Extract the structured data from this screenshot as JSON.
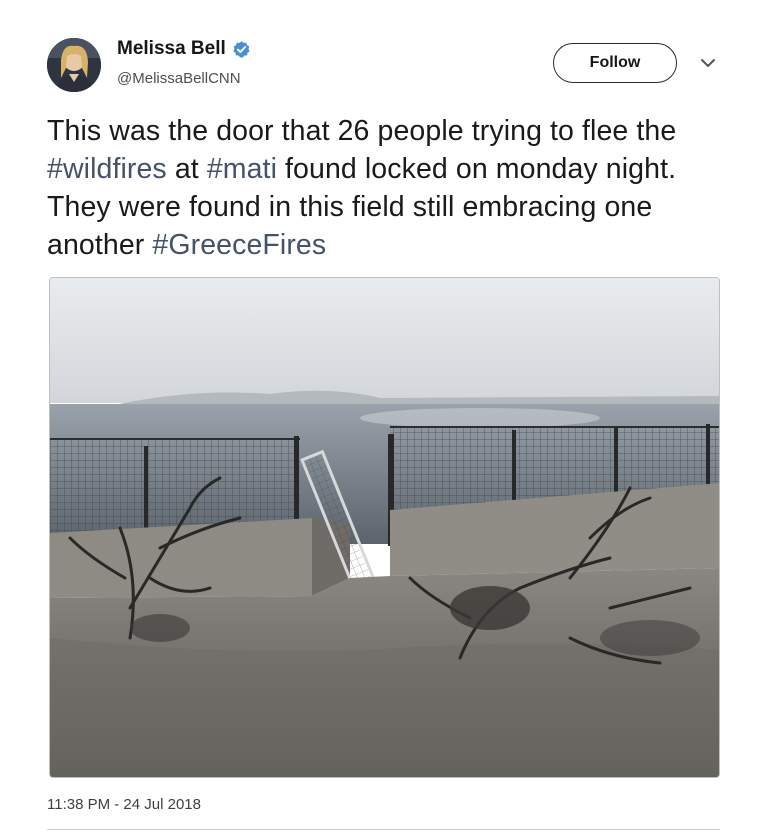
{
  "tweet": {
    "display_name": "Melissa Bell",
    "handle": "@MelissaBellCNN",
    "follow_label": "Follow",
    "text_segments": [
      {
        "text": "This was the door that 26 people trying to flee the ",
        "hashtag": false
      },
      {
        "text": "#wildfires",
        "hashtag": true
      },
      {
        "text": " at ",
        "hashtag": false
      },
      {
        "text": "#mati",
        "hashtag": true
      },
      {
        "text": " found locked on monday night. They were found in this field still embracing one another ",
        "hashtag": false
      },
      {
        "text": "#GreeceFires",
        "hashtag": true
      }
    ],
    "timestamp": "11:38 PM - 24 Jul 2018"
  },
  "colors": {
    "hashtag": "#44526a",
    "verified": "#1da1f2",
    "text": "#1a1a1a"
  },
  "icons": {
    "verified": "verified-badge-icon",
    "more": "chevron-down-icon"
  }
}
